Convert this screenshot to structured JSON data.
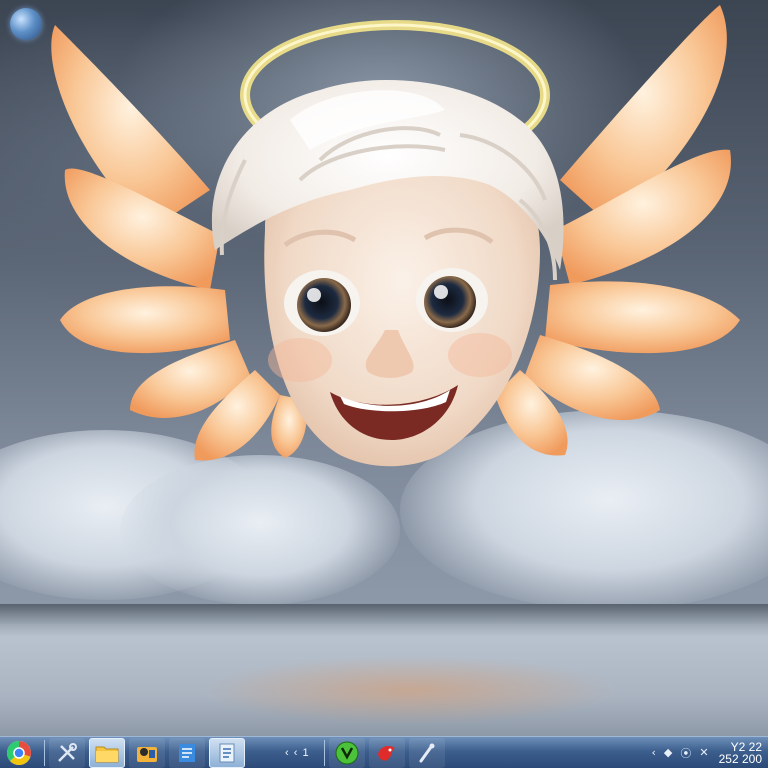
{
  "desktop": {
    "wallpaper": "smiling-cherub-with-halo-and-wings",
    "desktop_icon": "glass-orb-icon"
  },
  "taskbar": {
    "start_icon": "start-orb-icon",
    "quick_launch": [
      {
        "name": "tools-icon"
      },
      {
        "name": "folder-icon"
      },
      {
        "name": "media-player-icon"
      },
      {
        "name": "document-icon"
      },
      {
        "name": "notepad-icon"
      }
    ],
    "middle_text": "‹ ‹ 1",
    "apps": [
      {
        "name": "green-app-icon"
      },
      {
        "name": "red-bird-icon"
      },
      {
        "name": "pen-tool-icon"
      }
    ],
    "tray_glyphs": [
      "‹",
      "◆",
      "⦿",
      "✕"
    ],
    "clock": {
      "line1": "Y2 22",
      "line2": "252 200"
    }
  },
  "colors": {
    "taskbar": "#3d5f8e",
    "halo": "#f5e58a",
    "wing": "#f7b987",
    "face": "#f5e6d9"
  }
}
